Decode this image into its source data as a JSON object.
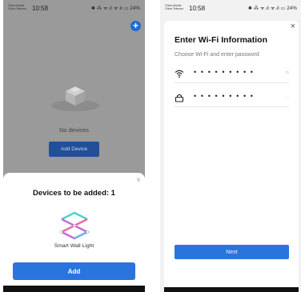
{
  "left_screen": {
    "status": {
      "carrier": "China Mobile China Telecom",
      "time": "10:58",
      "icons": "✱ ⁂ ᯤ.ıl ᯤ.ıl ▭ 24%"
    },
    "empty_state": {
      "message": "No devices",
      "add_device_label": "Add Device"
    },
    "bottom_sheet": {
      "title": "Devices to be added: 1",
      "device_name": "Smart Wall Light",
      "add_label": "Add",
      "close_glyph": "×"
    },
    "fab_glyph": "+"
  },
  "right_screen": {
    "status": {
      "carrier": "China Mobile China Telecom",
      "time": "10:58",
      "icons": "✱ ⁂ ᯤ.ıl ᯤ.ıl ▭ 24%"
    },
    "dialog": {
      "title": "Enter Wi-Fi Information",
      "subtitle": "Choose Wi-Fi and enter password",
      "ssid_value": "• • • • • • • • •",
      "ssid_trailing": "⇆",
      "password_value": "• • • • • • • • •",
      "password_trailing": "◡",
      "next_label": "Next",
      "close_glyph": "×"
    }
  },
  "colors": {
    "primary": "#2a74de",
    "overlay": "#9a9a9a",
    "dark_button": "#214f98"
  }
}
